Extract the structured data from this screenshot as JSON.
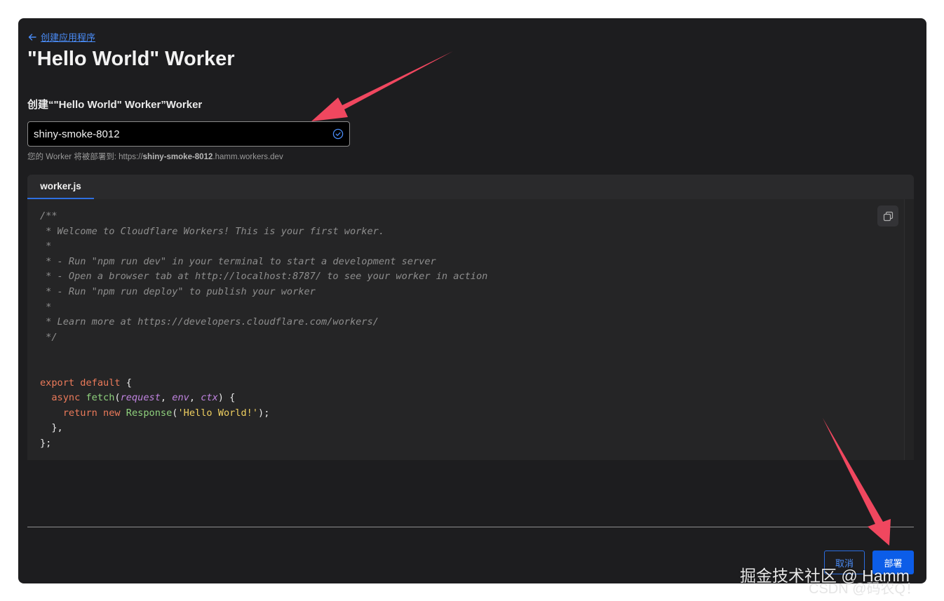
{
  "header": {
    "back_label": "创建应用程序",
    "title": "\"Hello World\" Worker"
  },
  "form": {
    "name_label": "创建“\"Hello World\" Worker”Worker",
    "name_value": "shiny-smoke-8012",
    "hint_prefix": "您的 Worker 将被部署到: https://",
    "hint_sub": "shiny-smoke-8012",
    "hint_suffix": ".hamm.workers.dev"
  },
  "editor": {
    "tab_label": "worker.js",
    "code_lines": [
      "/**",
      " * Welcome to Cloudflare Workers! This is your first worker.",
      " *",
      " * - Run \"npm run dev\" in your terminal to start a development server",
      " * - Open a browser tab at http://localhost:8787/ to see your worker in action",
      " * - Run \"npm run deploy\" to publish your worker",
      " *",
      " * Learn more at https://developers.cloudflare.com/workers/",
      " */",
      "",
      "",
      "export default {",
      "  async fetch(request, env, ctx) {",
      "    return new Response('Hello World!');",
      "  },",
      "};"
    ]
  },
  "footer": {
    "cancel_label": "取消",
    "deploy_label": "部署"
  },
  "watermark": {
    "line1": "掘金技术社区 @ Hamm",
    "line2": "CSDN @码农Q！"
  },
  "colors": {
    "panel_bg": "#1d1d1f",
    "accent": "#0c5de8",
    "link": "#4a8cf7",
    "annotation_arrow": "#f0475f"
  }
}
